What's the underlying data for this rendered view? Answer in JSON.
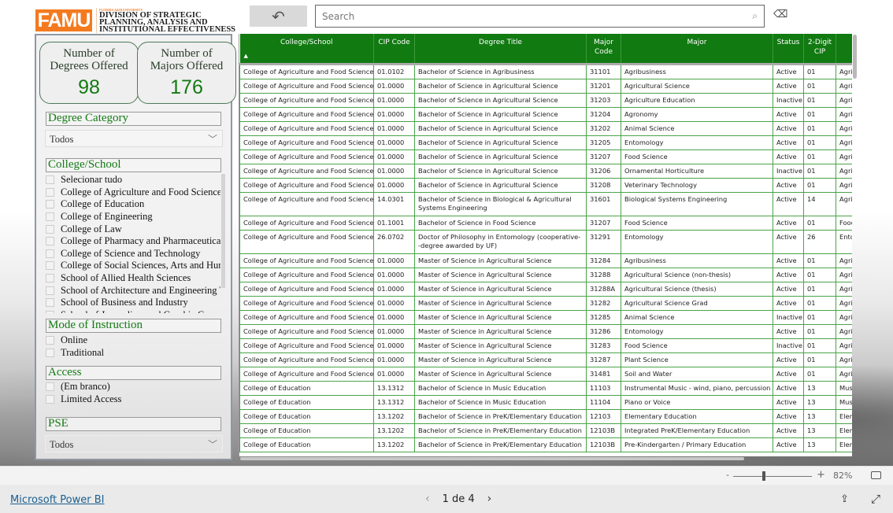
{
  "header": {
    "logo_text": "FAMU",
    "logo_sub": "FLORIDA A&M UNIVERSITY",
    "division": [
      "DIVISION OF STRATEGIC",
      "PLANNING, ANALYSIS AND",
      "INSTITUTIONAL EFFECTIVENESS"
    ],
    "search_placeholder": "Search",
    "brand_color": "#f47a20"
  },
  "cards": [
    {
      "label1": "Number of",
      "label2": "Degrees Offered",
      "value": "98"
    },
    {
      "label1": "Number of",
      "label2": "Majors Offered",
      "value": "176"
    }
  ],
  "filters": {
    "degree_category": {
      "title": "Degree Category",
      "selected": "Todos"
    },
    "college": {
      "title": "College/School",
      "items": [
        "Selecionar tudo",
        "College of Agriculture and Food Sciences",
        "College of Education",
        "College of Engineering",
        "College of Law",
        "College of Pharmacy and Pharmaceutical ...",
        "College of Science and Technology",
        "College of Social Sciences, Arts and Hum...",
        "School of Allied Health Sciences",
        "School of Architecture and Engineering T...",
        "School of Business and Industry",
        "School of Journalism and Graphic Comm..."
      ]
    },
    "mode": {
      "title": "Mode of Instruction",
      "items": [
        "Online",
        "Traditional"
      ]
    },
    "access": {
      "title": "Access",
      "items": [
        "(Em branco)",
        "Limited Access"
      ]
    },
    "pse": {
      "title": "PSE",
      "selected": "Todos"
    }
  },
  "table": {
    "header_color": "#117a11",
    "columns": [
      "College/School",
      "CIP Code",
      "Degree Title",
      "Major Code",
      "Major",
      "Status",
      "2-Digit CIP",
      ""
    ],
    "rows": [
      [
        "College of Agriculture and Food Sciences",
        "01.0102",
        "Bachelor of Science in Agribusiness",
        "31101",
        "Agribusiness",
        "Active",
        "01",
        "Agrib"
      ],
      [
        "College of Agriculture and Food Sciences",
        "01.0000",
        "Bachelor of Science in Agricultural Science",
        "31201",
        "Agricultural Science",
        "Active",
        "01",
        "Agric"
      ],
      [
        "College of Agriculture and Food Sciences",
        "01.0000",
        "Bachelor of Science in Agricultural Science",
        "31203",
        "Agriculture Education",
        "Inactive",
        "01",
        "Agric"
      ],
      [
        "College of Agriculture and Food Sciences",
        "01.0000",
        "Bachelor of Science in Agricultural Science",
        "31204",
        "Agronomy",
        "Active",
        "01",
        "Agric"
      ],
      [
        "College of Agriculture and Food Sciences",
        "01.0000",
        "Bachelor of Science in Agricultural Science",
        "31202",
        "Animal Science",
        "Active",
        "01",
        "Agric"
      ],
      [
        "College of Agriculture and Food Sciences",
        "01.0000",
        "Bachelor of Science in Agricultural Science",
        "31205",
        "Entomology",
        "Active",
        "01",
        "Agric"
      ],
      [
        "College of Agriculture and Food Sciences",
        "01.0000",
        "Bachelor of Science in Agricultural Science",
        "31207",
        "Food Science",
        "Active",
        "01",
        "Agric"
      ],
      [
        "College of Agriculture and Food Sciences",
        "01.0000",
        "Bachelor of Science in Agricultural Science",
        "31206",
        "Ornamental Horticulture",
        "Inactive",
        "01",
        "Agric"
      ],
      [
        "College of Agriculture and Food Sciences",
        "01.0000",
        "Bachelor of Science in Agricultural Science",
        "31208",
        "Veterinary Technology",
        "Active",
        "01",
        "Agric"
      ],
      [
        "College of Agriculture and Food Sciences",
        "14.0301",
        "Bachelor of Science in Biological & Agricultural Systems Engineering",
        "31601",
        "Biological Systems Engineering",
        "Active",
        "14",
        "Agric"
      ],
      [
        "College of Agriculture and Food Sciences",
        "01.1001",
        "Bachelor of Science in Food Science",
        "31207",
        "Food Science",
        "Active",
        "01",
        "Food"
      ],
      [
        "College of Agriculture and Food Sciences",
        "26.0702",
        "Doctor of Philosophy in Entomology (cooperative--degree awarded by UF)",
        "31291",
        "Entomology",
        "Active",
        "26",
        "Ento"
      ],
      [
        "College of Agriculture and Food Sciences",
        "01.0000",
        "Master of Science in Agricultural Science",
        "31284",
        "Agribusiness",
        "Active",
        "01",
        "Agric"
      ],
      [
        "College of Agriculture and Food Sciences",
        "01.0000",
        "Master of Science in Agricultural Science",
        "31288",
        "Agricultural Science (non-thesis)",
        "Active",
        "01",
        "Agric"
      ],
      [
        "College of Agriculture and Food Sciences",
        "01.0000",
        "Master of Science in Agricultural Science",
        "31288A",
        "Agricultural Science (thesis)",
        "Active",
        "01",
        "Agric"
      ],
      [
        "College of Agriculture and Food Sciences",
        "01.0000",
        "Master of Science in Agricultural Science",
        "31282",
        "Agricultural Science Grad",
        "Active",
        "01",
        "Agric"
      ],
      [
        "College of Agriculture and Food Sciences",
        "01.0000",
        "Master of Science in Agricultural Science",
        "31285",
        "Animal Science",
        "Inactive",
        "01",
        "Agric"
      ],
      [
        "College of Agriculture and Food Sciences",
        "01.0000",
        "Master of Science in Agricultural Science",
        "31286",
        "Entomology",
        "Active",
        "01",
        "Agric"
      ],
      [
        "College of Agriculture and Food Sciences",
        "01.0000",
        "Master of Science in Agricultural Science",
        "31283",
        "Food Science",
        "Inactive",
        "01",
        "Agric"
      ],
      [
        "College of Agriculture and Food Sciences",
        "01.0000",
        "Master of Science in Agricultural Science",
        "31287",
        "Plant Science",
        "Active",
        "01",
        "Agric"
      ],
      [
        "College of Agriculture and Food Sciences",
        "01.0000",
        "Master of Science in Agricultural Science",
        "31481",
        "Soil and Water",
        "Active",
        "01",
        "Agric"
      ],
      [
        "College of Education",
        "13.1312",
        "Bachelor of Science in Music Education",
        "11103",
        "Instrumental Music - wind, piano, percussion",
        "Active",
        "13",
        "Musi"
      ],
      [
        "College of Education",
        "13.1312",
        "Bachelor of Science in Music Education",
        "11104",
        "Piano or Voice",
        "Active",
        "13",
        "Musi"
      ],
      [
        "College of Education",
        "13.1202",
        "Bachelor of Science in PreK/Elementary Education",
        "12103",
        "Elementary Education",
        "Active",
        "13",
        "Elem"
      ],
      [
        "College of Education",
        "13.1202",
        "Bachelor of Science in PreK/Elementary Education",
        "12103B",
        "Integrated PreK/Elementary Education",
        "Active",
        "13",
        "Elem"
      ],
      [
        "College of Education",
        "13.1202",
        "Bachelor of Science in PreK/Elementary Education",
        "12103B",
        "Pre-Kindergarten / Primary Education",
        "Active",
        "13",
        "Elem"
      ]
    ]
  },
  "zoom": {
    "minus": "-",
    "plus": "+",
    "level": "82%",
    "level_value": 82
  },
  "footer": {
    "brand": "Microsoft Power BI",
    "page": "1 de 4"
  }
}
